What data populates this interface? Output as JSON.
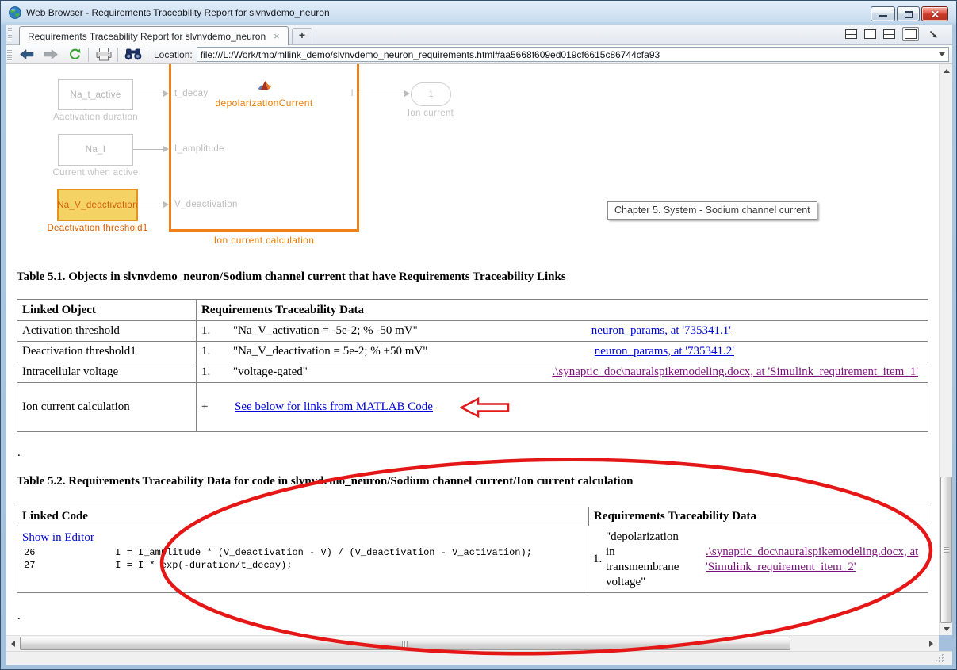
{
  "window": {
    "title": "Web Browser - Requirements Traceability Report for slvnvdemo_neuron"
  },
  "tabbar": {
    "tab_title": "Requirements Traceability Report for slvnvdemo_neuron"
  },
  "icons": {
    "tab_close": "×",
    "new_tab": "+"
  },
  "toolbar": {
    "location_label": "Location:",
    "location_value": "file:///L:/Work/tmp/mllink_demo/slvnvdemo_neuron_requirements.html#aa5668f609ed019cf6615c86744cfa93"
  },
  "diagram": {
    "block_na_t_active": {
      "name": "Na_t_active",
      "caption": "Aactivation duration"
    },
    "block_na_i": {
      "name": "Na_I",
      "caption": "Current when active"
    },
    "block_na_v_deactivation": {
      "name": "Na_V_deactivation",
      "caption": "Deactivation threshold1"
    },
    "subsystem": {
      "title": "depolarizationCurrent",
      "caption": "Ion current calculation",
      "port1": "t_decay",
      "port2": "I_amplitude",
      "port3": "V_deactivation",
      "out_port": "I"
    },
    "outport": {
      "value": "1",
      "caption": "Ion current"
    },
    "tooltip": "Chapter 5. System - Sodium channel current"
  },
  "table1": {
    "title": "Table 5.1. Objects in slvnvdemo_neuron/Sodium channel current that have Requirements Traceability Links",
    "col1": "Linked Object",
    "col2": "Requirements Traceability Data",
    "rows": [
      {
        "object": "Activation threshold",
        "num": "1.",
        "text": "\"Na_V_activation = -5e-2; % -50 mV\"",
        "link": "neuron_params, at '735341.1'"
      },
      {
        "object": "Deactivation threshold1",
        "num": "1.",
        "text": "\"Na_V_deactivation = 5e-2; % +50 mV\"",
        "link": "neuron_params, at '735341.2'"
      },
      {
        "object": "Intracellular voltage",
        "num": "1.",
        "text": "\"voltage-gated\"",
        "link": ".\\synaptic_doc\\nauralspikemodeling.docx, at 'Simulink_requirement_item_1'"
      },
      {
        "object": "Ion current calculation",
        "num": "+",
        "link": "See below for links from MATLAB Code"
      }
    ]
  },
  "between_tables_dot": ".",
  "table2": {
    "title": "Table 5.2. Requirements Traceability Data for code in slvnvdemo_neuron/Sodium channel current/Ion current calculation",
    "col1": "Linked Code",
    "col2": "Requirements Traceability Data",
    "show_in_editor": "Show in Editor",
    "code_line1": "26              I = I_amplitude * (V_deactivation - V) / (V_deactivation - V_activation);",
    "code_line2": "27              I = I * exp(-duration/t_decay);",
    "req_num": "1.",
    "req_text": "\"depolarization in transmembrane voltage\"",
    "req_link": ".\\synaptic_doc\\nauralspikemodeling.docx, at 'Simulink_requirement_item_2'"
  },
  "bottom_dot": "."
}
